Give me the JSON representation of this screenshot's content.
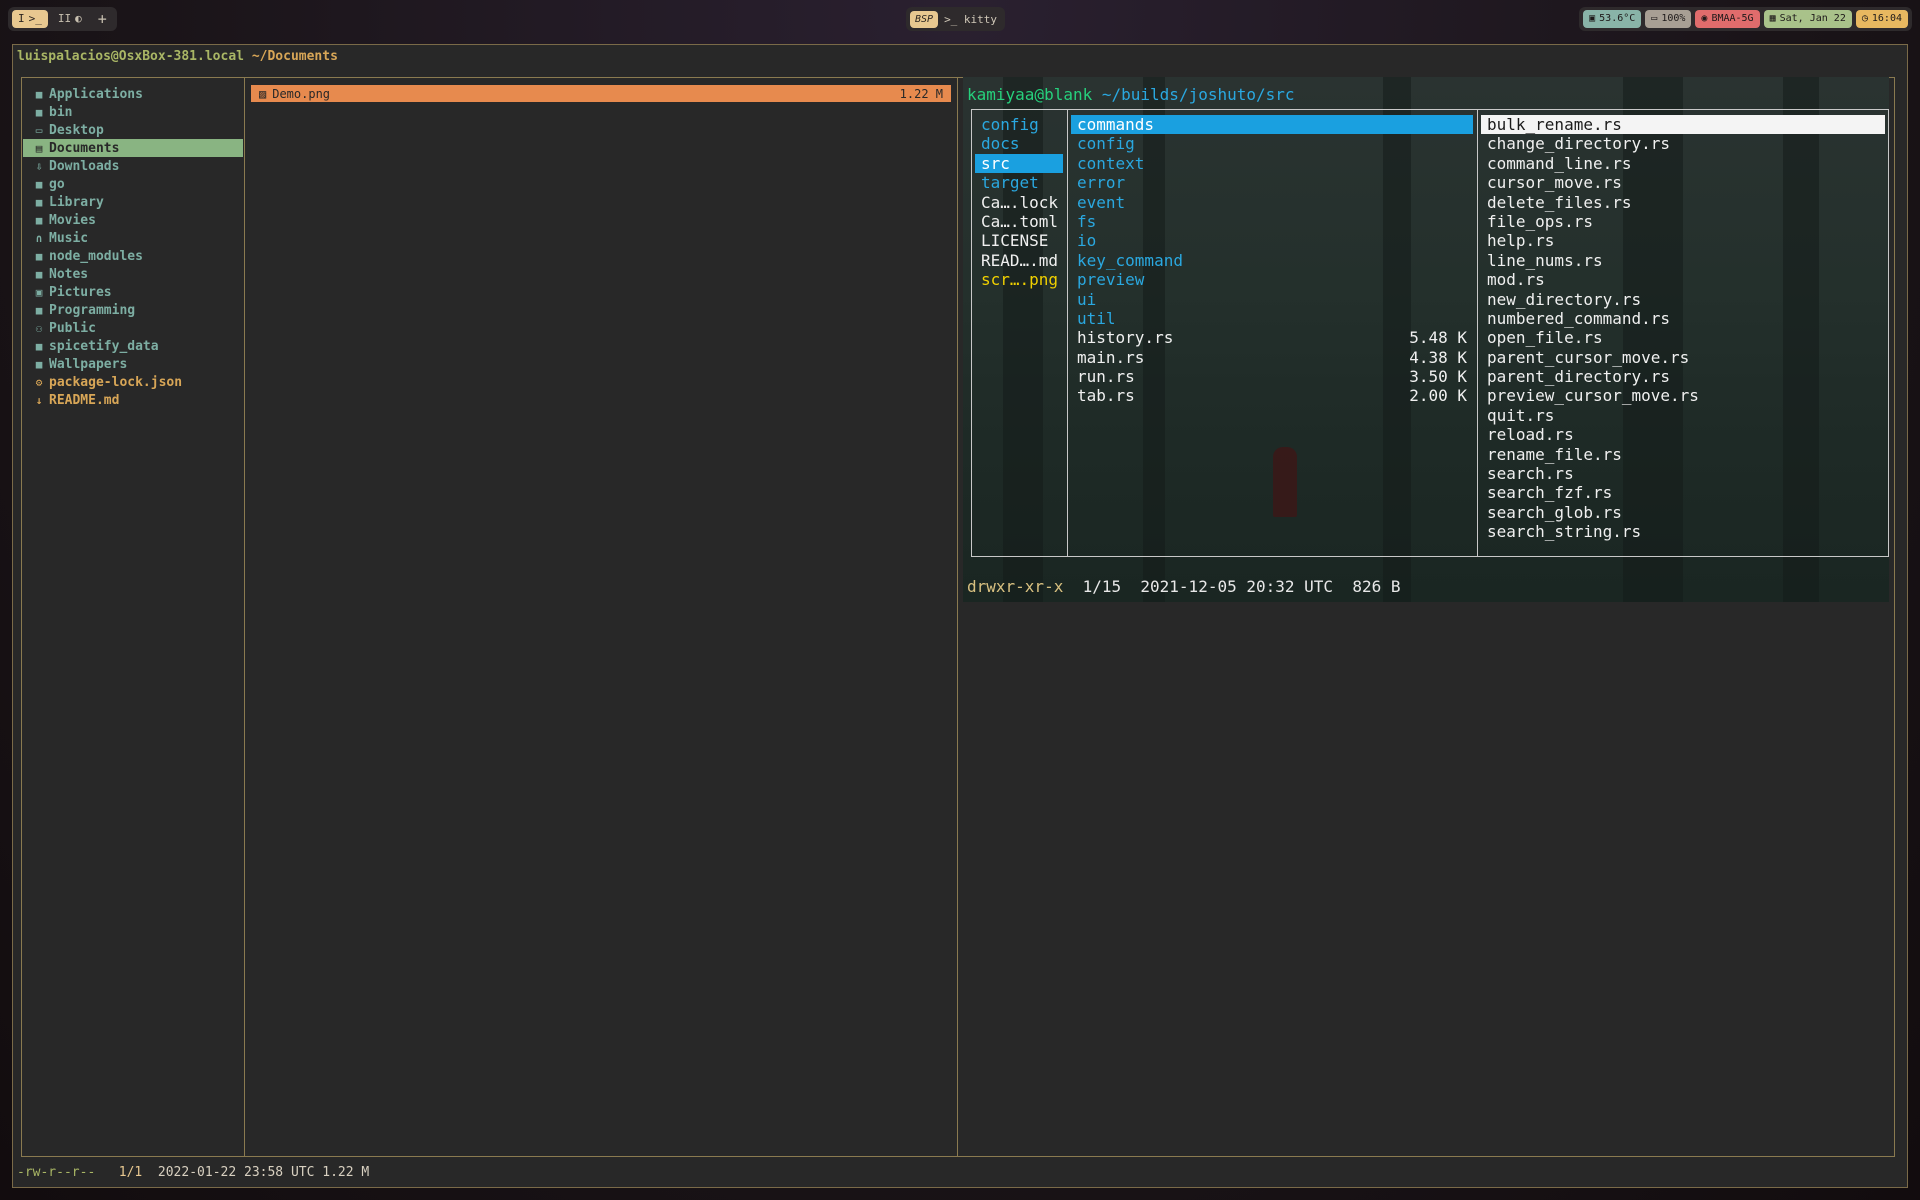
{
  "topbar": {
    "workspaces": [
      {
        "label": "I",
        "icon": ">_",
        "active": true
      },
      {
        "label": "II",
        "icon": "◐",
        "active": false
      }
    ],
    "add_label": "+",
    "layout_label": "BSP",
    "app_label": ">_ kitty",
    "status": [
      {
        "name": "temp",
        "icon": "▣",
        "text": "53.6°C",
        "color": "#89b4a8"
      },
      {
        "name": "battery",
        "icon": "▭",
        "text": "100%",
        "color": "#a89f94"
      },
      {
        "name": "wifi",
        "icon": "◉",
        "text": "BMAA-5G",
        "color": "#e06c6c"
      },
      {
        "name": "date",
        "icon": "▦",
        "text": "Sat, Jan 22",
        "color": "#a9c28a"
      },
      {
        "name": "time",
        "icon": "◷",
        "text": "16:04",
        "color": "#e8b860"
      }
    ]
  },
  "terminal": {
    "title_user": "luispalacios@OsxBox-381.local",
    "title_path": "~/Documents",
    "sidebar": [
      {
        "label": "Applications",
        "icon": "folder",
        "kind": "dir"
      },
      {
        "label": "bin",
        "icon": "folder",
        "kind": "dir"
      },
      {
        "label": "Desktop",
        "icon": "monitor",
        "kind": "dir"
      },
      {
        "label": "Documents",
        "icon": "document",
        "kind": "dir",
        "selected": true
      },
      {
        "label": "Downloads",
        "icon": "download",
        "kind": "dir"
      },
      {
        "label": "go",
        "icon": "folder",
        "kind": "dir"
      },
      {
        "label": "Library",
        "icon": "folder",
        "kind": "dir"
      },
      {
        "label": "Movies",
        "icon": "folder",
        "kind": "dir"
      },
      {
        "label": "Music",
        "icon": "headphones",
        "kind": "dir"
      },
      {
        "label": "node_modules",
        "icon": "folder",
        "kind": "dir"
      },
      {
        "label": "Notes",
        "icon": "folder",
        "kind": "dir"
      },
      {
        "label": "Pictures",
        "icon": "picture",
        "kind": "dir"
      },
      {
        "label": "Programming",
        "icon": "folder",
        "kind": "dir"
      },
      {
        "label": "Public",
        "icon": "users",
        "kind": "dir"
      },
      {
        "label": "spicetify_data",
        "icon": "folder",
        "kind": "dir"
      },
      {
        "label": "Wallpapers",
        "icon": "folder",
        "kind": "dir"
      },
      {
        "label": "package-lock.json",
        "icon": "json",
        "kind": "file"
      },
      {
        "label": "README.md",
        "icon": "markdown",
        "kind": "file"
      }
    ],
    "middle": [
      {
        "name": "Demo.png",
        "size": "1.22 M"
      }
    ],
    "status": {
      "perm": "-rw-r--r--",
      "pos": "1/1",
      "info": "2022-01-22 23:58 UTC 1.22 M"
    }
  },
  "preview": {
    "title_user": "kamiyaa@blank",
    "title_path": "~/builds/joshuto/src",
    "parent": [
      {
        "label": "config",
        "color": "blue"
      },
      {
        "label": "docs",
        "color": "blue"
      },
      {
        "label": "src",
        "color": "blue",
        "selected": true
      },
      {
        "label": "target",
        "color": "blue"
      },
      {
        "label": "Ca….lock",
        "color": "white"
      },
      {
        "label": "Ca….toml",
        "color": "white"
      },
      {
        "label": "LICENSE",
        "color": "white"
      },
      {
        "label": "READ….md",
        "color": "white"
      },
      {
        "label": "scr….png",
        "color": "yellow"
      }
    ],
    "current": [
      {
        "label": "commands",
        "size": "",
        "color": "blue",
        "selected": true
      },
      {
        "label": "config",
        "size": "",
        "color": "blue"
      },
      {
        "label": "context",
        "size": "",
        "color": "blue"
      },
      {
        "label": "error",
        "size": "",
        "color": "blue"
      },
      {
        "label": "event",
        "size": "",
        "color": "blue"
      },
      {
        "label": "fs",
        "size": "",
        "color": "blue"
      },
      {
        "label": "io",
        "size": "",
        "color": "blue"
      },
      {
        "label": "key_command",
        "size": "",
        "color": "blue"
      },
      {
        "label": "preview",
        "size": "",
        "color": "blue"
      },
      {
        "label": "ui",
        "size": "",
        "color": "blue"
      },
      {
        "label": "util",
        "size": "",
        "color": "blue"
      },
      {
        "label": "history.rs",
        "size": "5.48 K",
        "color": "white"
      },
      {
        "label": "main.rs",
        "size": "4.38 K",
        "color": "white"
      },
      {
        "label": "run.rs",
        "size": "3.50 K",
        "color": "white"
      },
      {
        "label": "tab.rs",
        "size": "2.00 K",
        "color": "white"
      }
    ],
    "child": [
      {
        "label": "bulk_rename.rs",
        "selected": true
      },
      {
        "label": "change_directory.rs"
      },
      {
        "label": "command_line.rs"
      },
      {
        "label": "cursor_move.rs"
      },
      {
        "label": "delete_files.rs"
      },
      {
        "label": "file_ops.rs"
      },
      {
        "label": "help.rs"
      },
      {
        "label": "line_nums.rs"
      },
      {
        "label": "mod.rs"
      },
      {
        "label": "new_directory.rs"
      },
      {
        "label": "numbered_command.rs"
      },
      {
        "label": "open_file.rs"
      },
      {
        "label": "parent_cursor_move.rs"
      },
      {
        "label": "parent_directory.rs"
      },
      {
        "label": "preview_cursor_move.rs"
      },
      {
        "label": "quit.rs"
      },
      {
        "label": "reload.rs"
      },
      {
        "label": "rename_file.rs"
      },
      {
        "label": "search.rs"
      },
      {
        "label": "search_fzf.rs"
      },
      {
        "label": "search_glob.rs"
      },
      {
        "label": "search_string.rs"
      }
    ],
    "status": {
      "perm": "drwxr-xr-x",
      "rest": "  1/15  2021-12-05 20:32 UTC  826 B"
    }
  }
}
